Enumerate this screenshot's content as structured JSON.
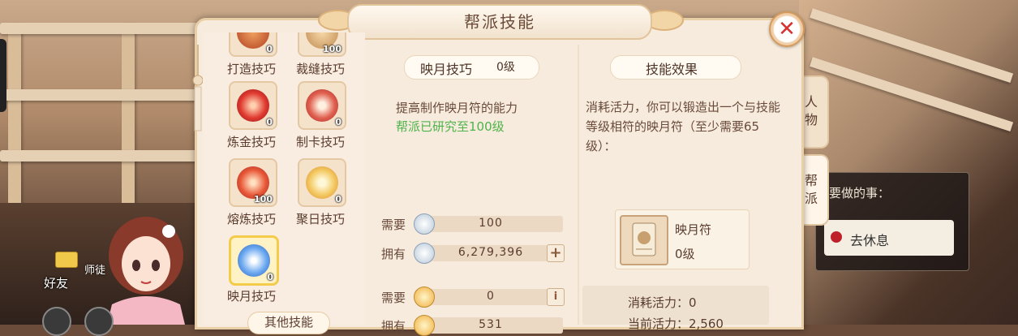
{
  "dialog": {
    "title": "帮派技能",
    "close_label": "✕"
  },
  "tabs": [
    {
      "label": "人物"
    },
    {
      "label": "帮派"
    }
  ],
  "skills": [
    {
      "name": "打造技巧",
      "count": "0",
      "icon": "forging-icon"
    },
    {
      "name": "裁缝技巧",
      "count": "100",
      "icon": "tailoring-icon"
    },
    {
      "name": "炼金技巧",
      "count": "0",
      "icon": "alchemy-icon"
    },
    {
      "name": "制卡技巧",
      "count": "0",
      "icon": "card-making-icon"
    },
    {
      "name": "熔炼技巧",
      "count": "100",
      "icon": "smelting-icon"
    },
    {
      "name": "聚日技巧",
      "count": "0",
      "icon": "sun-gathering-icon"
    },
    {
      "name": "映月技巧",
      "count": "0",
      "icon": "moon-reflection-icon",
      "selected": true
    }
  ],
  "other_skills_label": "其他技能",
  "selected_skill": {
    "name": "映月技巧",
    "level": "0级",
    "description": "提高制作映月符的能力",
    "research_status": "帮派已研究至100级"
  },
  "resources": [
    {
      "label": "需要",
      "icon": "silver-coin-icon",
      "value": "100",
      "has_plus": false
    },
    {
      "label": "拥有",
      "icon": "silver-coin-icon",
      "value": "6,279,396",
      "has_plus": true
    },
    {
      "label": "需要",
      "icon": "gold-coin-icon",
      "value": "0",
      "has_info": true
    },
    {
      "label": "拥有",
      "icon": "gold-coin-icon",
      "value": "531"
    }
  ],
  "effect": {
    "title": "技能效果",
    "text": "消耗活力，你可以锻造出一个与技能等级相符的映月符（至少需要65级）：",
    "item_name": "映月符",
    "item_level": "0级",
    "stat_consume": "消耗活力：0",
    "stat_current": "当前活力：2,560"
  },
  "hud": {
    "friend_label": "好友",
    "master_label": "师徒",
    "todo_title": "要做的事：",
    "todo_item": "去休息"
  },
  "colors": {
    "accent": "#d8302e",
    "research_green": "#4eb34a",
    "panel_bg": "#f6ebdd"
  }
}
